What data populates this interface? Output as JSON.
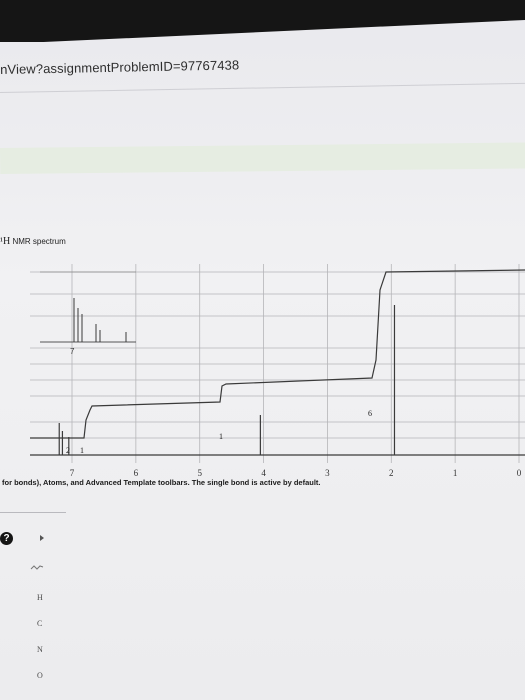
{
  "browser": {
    "url_fragment": "nView?assignmentProblemID=97767438"
  },
  "nmr_panel": {
    "title_prefix": "¹H",
    "title_rest": " NMR spectrum",
    "x_axis_ticks": [
      "7",
      "6",
      "5",
      "4",
      "3",
      "2",
      "1",
      "0"
    ],
    "inset_tick": "7",
    "integration_labels": [
      "2",
      "1",
      "1",
      "6"
    ]
  },
  "chart_data": {
    "type": "line",
    "title": "¹H NMR spectrum",
    "xlabel": "",
    "ylabel": "",
    "xlim": [
      7.3,
      0
    ],
    "x_ticks": [
      7,
      6,
      5,
      4,
      3,
      2,
      1,
      0
    ],
    "peaks_ppm": [
      7.2,
      7.15,
      7.05,
      4.05,
      1.95
    ],
    "integrations": [
      {
        "ppm": 7.1,
        "label": "2"
      },
      {
        "ppm": 7.05,
        "label": "1"
      },
      {
        "ppm": 4.05,
        "label": "1"
      },
      {
        "ppm": 1.95,
        "label": "6"
      }
    ]
  },
  "instructions": {
    "text": "for bonds), Atoms, and Advanced Template toolbars. The single bond is active by default."
  },
  "toolbar": {
    "help_label": "?",
    "atoms": [
      "H",
      "C",
      "N",
      "O"
    ]
  },
  "colors": {
    "trace": "#3a3a3a",
    "grid": "#b5b5b8",
    "page": "#ededef",
    "topbar": "#151515"
  }
}
